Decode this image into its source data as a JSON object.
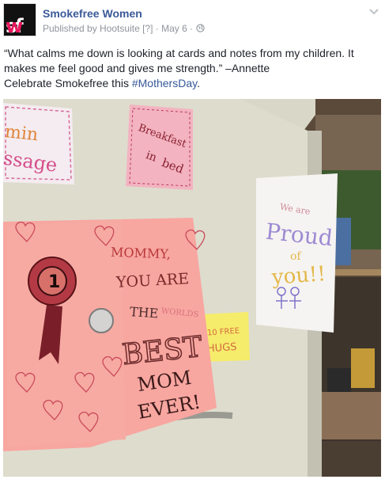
{
  "page": {
    "avatar_letters": [
      "sf",
      "w"
    ],
    "name": "Smokefree Women",
    "published_by": "Published by Hootsuite",
    "help_marker": "[?]",
    "date": "May 6",
    "separator": "·",
    "text_line1": "“What calms me down is looking at cards and notes from my children. It",
    "text_line2": "makes me feel good and gives me strength.” –Annette",
    "text_line3_prefix": "Celebrate Smokefree this ",
    "hashtag": "#MothersDay",
    "text_line3_suffix": "."
  },
  "photo": {
    "card_left_top": [
      "min",
      "ssage"
    ],
    "card_breakfast": [
      "Breakfast",
      "in",
      "bed"
    ],
    "card_proud": [
      "We are",
      "Proud",
      "of",
      "you!!"
    ],
    "card_mommy": [
      "MOMMY,",
      "YOU ARE",
      "THE",
      "WORLDS",
      "BEST",
      "MOM",
      "EVER!"
    ],
    "ribbon_number": "1",
    "card_hugs": [
      "10 FREE",
      "HUGS"
    ]
  },
  "colors": {
    "brand_pink": "#e8175d",
    "link_blue": "#3b5998",
    "hashtag_blue": "#365899"
  }
}
